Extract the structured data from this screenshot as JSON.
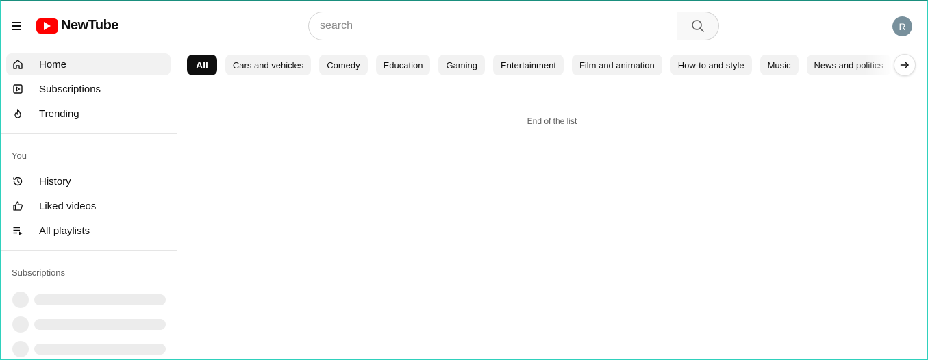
{
  "header": {
    "brand": "NewTube",
    "search_placeholder": "search",
    "avatar_initial": "R",
    "brand_color": "#ff0000"
  },
  "sidebar": {
    "main_items": [
      {
        "label": "Home",
        "icon": "home-icon",
        "active": true
      },
      {
        "label": "Subscriptions",
        "icon": "subscriptions-icon"
      },
      {
        "label": "Trending",
        "icon": "flame-icon"
      }
    ],
    "you_title": "You",
    "you_items": [
      {
        "label": "History",
        "icon": "history-icon"
      },
      {
        "label": "Liked videos",
        "icon": "thumbs-up-icon"
      },
      {
        "label": "All playlists",
        "icon": "playlist-icon"
      }
    ],
    "subscriptions_title": "Subscriptions"
  },
  "chips": [
    "All",
    "Cars and vehicles",
    "Comedy",
    "Education",
    "Gaming",
    "Entertainment",
    "Film and animation",
    "How-to and style",
    "Music",
    "News and politics"
  ],
  "main": {
    "end_message": "End of the list"
  }
}
